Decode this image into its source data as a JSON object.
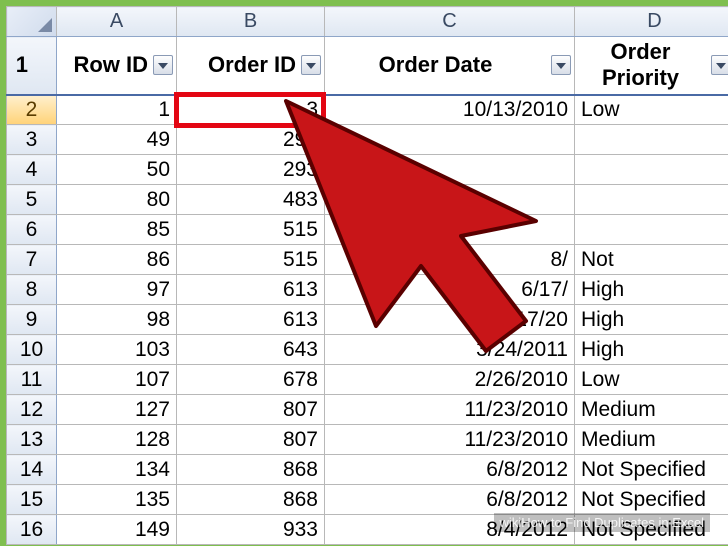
{
  "columns": {
    "A": "A",
    "B": "B",
    "C": "C",
    "D": "D"
  },
  "headers": {
    "A": "Row ID",
    "B": "Order ID",
    "C": "Order Date",
    "D": "Order Priority"
  },
  "rows": [
    {
      "n": "1"
    },
    {
      "n": "2",
      "A": "1",
      "B": "3",
      "C": "10/13/2010",
      "D": "Low"
    },
    {
      "n": "3",
      "A": "49",
      "B": "293",
      "C": "",
      "D": ""
    },
    {
      "n": "4",
      "A": "50",
      "B": "293",
      "C": "",
      "D": ""
    },
    {
      "n": "5",
      "A": "80",
      "B": "483",
      "C": "",
      "D": ""
    },
    {
      "n": "6",
      "A": "85",
      "B": "515",
      "C": "",
      "D": ""
    },
    {
      "n": "7",
      "A": "86",
      "B": "515",
      "C": "8/",
      "D": "Not"
    },
    {
      "n": "8",
      "A": "97",
      "B": "613",
      "C": "6/17/",
      "D": "High"
    },
    {
      "n": "9",
      "A": "98",
      "B": "613",
      "C": "6/17/20",
      "D": "High"
    },
    {
      "n": "10",
      "A": "103",
      "B": "643",
      "C": "3/24/2011",
      "D": "High"
    },
    {
      "n": "11",
      "A": "107",
      "B": "678",
      "C": "2/26/2010",
      "D": "Low"
    },
    {
      "n": "12",
      "A": "127",
      "B": "807",
      "C": "11/23/2010",
      "D": "Medium"
    },
    {
      "n": "13",
      "A": "128",
      "B": "807",
      "C": "11/23/2010",
      "D": "Medium"
    },
    {
      "n": "14",
      "A": "134",
      "B": "868",
      "C": "6/8/2012",
      "D": "Not Specified"
    },
    {
      "n": "15",
      "A": "135",
      "B": "868",
      "C": "6/8/2012",
      "D": "Not Specified"
    },
    {
      "n": "16",
      "A": "149",
      "B": "933",
      "C": "8/4/2012",
      "D": "Not Specified"
    }
  ],
  "selected_row": "2",
  "watermark": "wikiHow to Find Duplicates in Excel"
}
